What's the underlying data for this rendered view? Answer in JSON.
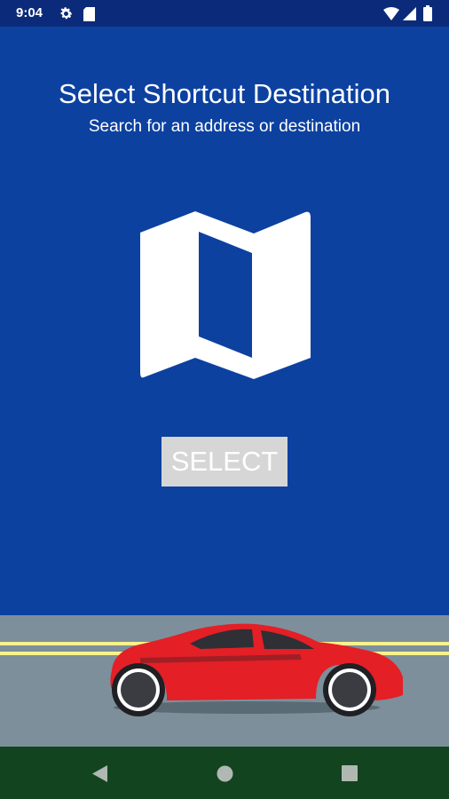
{
  "status_bar": {
    "time": "9:04",
    "icons": [
      "gear-icon",
      "sd-card-icon",
      "wifi-icon",
      "signal-icon",
      "battery-icon"
    ]
  },
  "header": {
    "title": "Select Shortcut Destination",
    "subtitle": "Search for an address or destination"
  },
  "illustration": {
    "icon": "map-icon"
  },
  "select_button": {
    "label": "SELECT"
  },
  "road_scene": {
    "icon": "car-icon"
  },
  "nav_bar": {
    "icons": [
      "back-icon",
      "home-icon",
      "recents-icon"
    ]
  },
  "colors": {
    "status_bar": "#0b2b7a",
    "background": "#0c41a0",
    "button": "#d6d6d6",
    "road": "#7d8f9a",
    "road_lines": "#f7f28b",
    "car": "#e41f26",
    "nav_bar": "#12441f"
  }
}
